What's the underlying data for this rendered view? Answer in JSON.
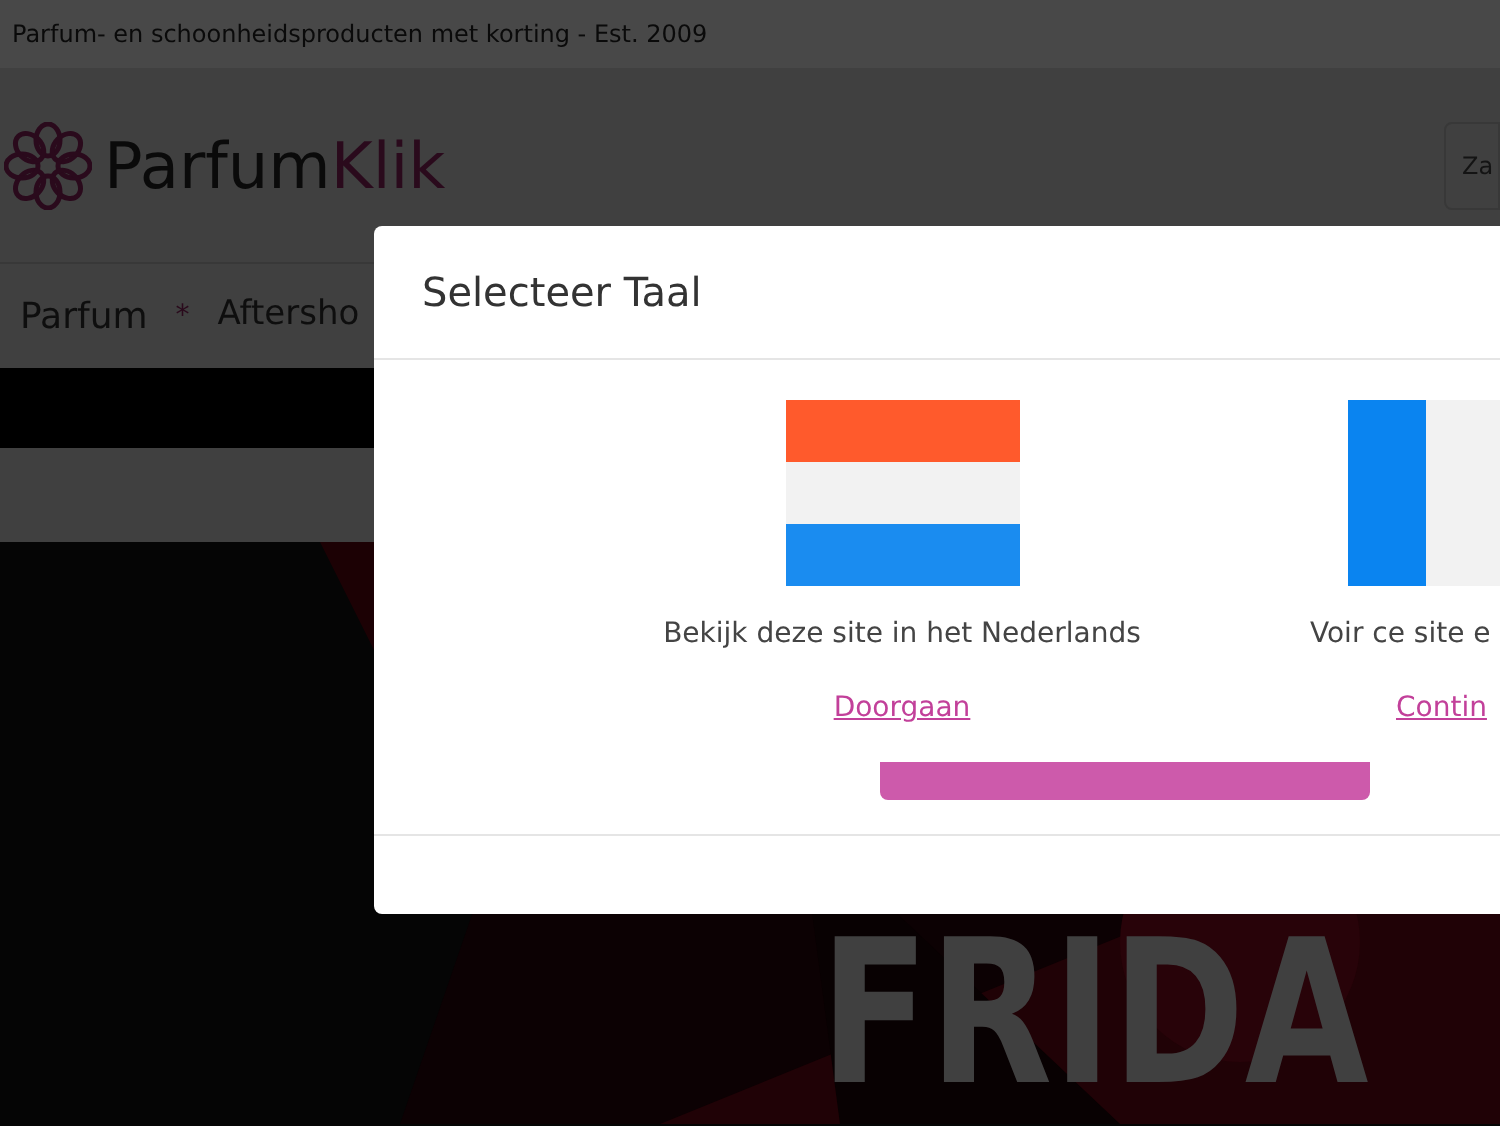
{
  "top_bar": {
    "tagline": "Parfum- en schoonheidsproducten met korting - Est. 2009"
  },
  "header": {
    "logo": {
      "part_1": "Parfum",
      "part_2": "Klik"
    },
    "search": {
      "placeholder": "Za"
    }
  },
  "nav": {
    "items": [
      {
        "label": "Parfum"
      },
      {
        "label": "Aftersho"
      }
    ],
    "separator": "*"
  },
  "hero": {
    "kind": "picture",
    "headline": "FRIDA"
  },
  "modal": {
    "title": "Selecteer Taal",
    "options": [
      {
        "text": "Bekijk deze site in het Nederlands",
        "link": "Doorgaan",
        "kind": "nl"
      },
      {
        "text": "Voir ce site e",
        "link": "Contin",
        "kind": "fr"
      }
    ]
  }
}
